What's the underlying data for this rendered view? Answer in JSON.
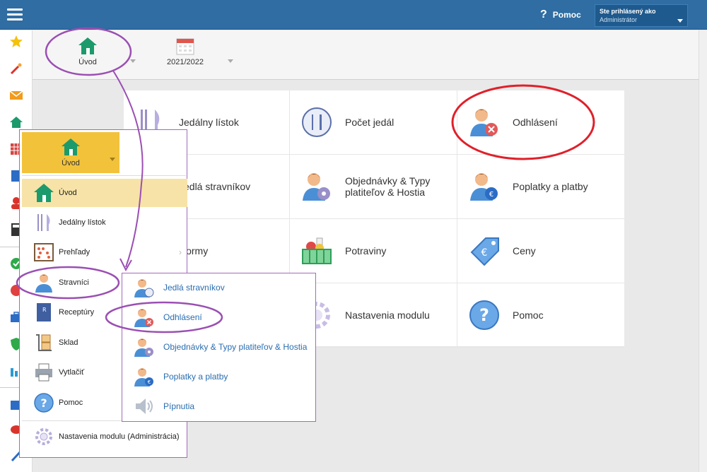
{
  "topbar": {
    "help_label": "Pomoc",
    "user_line1": "Ste prihlásený ako",
    "user_line2": "Administrátor"
  },
  "toolbar": {
    "home_label": "Úvod",
    "year_label": "2021/2022"
  },
  "tiles": [
    {
      "label": "Jedálny lístok",
      "icon": "cutlery-icon"
    },
    {
      "label": "Počet jedál",
      "icon": "plate-count-icon"
    },
    {
      "label": "Odhlásení",
      "icon": "user-cancel-icon"
    },
    {
      "label": "Jedlá stravníkov",
      "icon": "user-food-icon"
    },
    {
      "label": "Objednávky & Typy platiteľov & Hostia",
      "icon": "user-settings-icon"
    },
    {
      "label": "Poplatky a platby",
      "icon": "user-euro-icon"
    },
    {
      "label": "Normy",
      "icon": "norms-icon"
    },
    {
      "label": "Potraviny",
      "icon": "food-basket-icon"
    },
    {
      "label": "Ceny",
      "icon": "price-tag-icon"
    },
    {
      "label": "",
      "icon": "blank-icon"
    },
    {
      "label": "Nastavenia modulu",
      "icon": "gear-icon"
    },
    {
      "label": "Pomoc",
      "icon": "help-icon"
    }
  ],
  "menu": {
    "head_label": "Úvod",
    "items": [
      {
        "label": "Úvod"
      },
      {
        "label": "Jedálny lístok"
      },
      {
        "label": "Prehľady"
      },
      {
        "label": "Stravníci"
      },
      {
        "label": "Receptúry"
      },
      {
        "label": "Sklad"
      },
      {
        "label": "Vytlačiť"
      },
      {
        "label": "Pomoc"
      },
      {
        "label": "Nastavenia modulu (Administrácia)"
      }
    ]
  },
  "submenu": {
    "items": [
      {
        "label": "Jedlá stravníkov"
      },
      {
        "label": "Odhlásení"
      },
      {
        "label": "Objednávky & Typy platiteľov & Hostia"
      },
      {
        "label": "Poplatky a platby"
      },
      {
        "label": "Pípnutia"
      }
    ]
  },
  "colors": {
    "topbar": "#2f6da3",
    "accent_yellow": "#f2c23b",
    "highlight": "#f7e3a7",
    "annotation_purple": "#9b4fb3",
    "annotation_red": "#e0202a",
    "link_blue": "#2a6db0"
  }
}
